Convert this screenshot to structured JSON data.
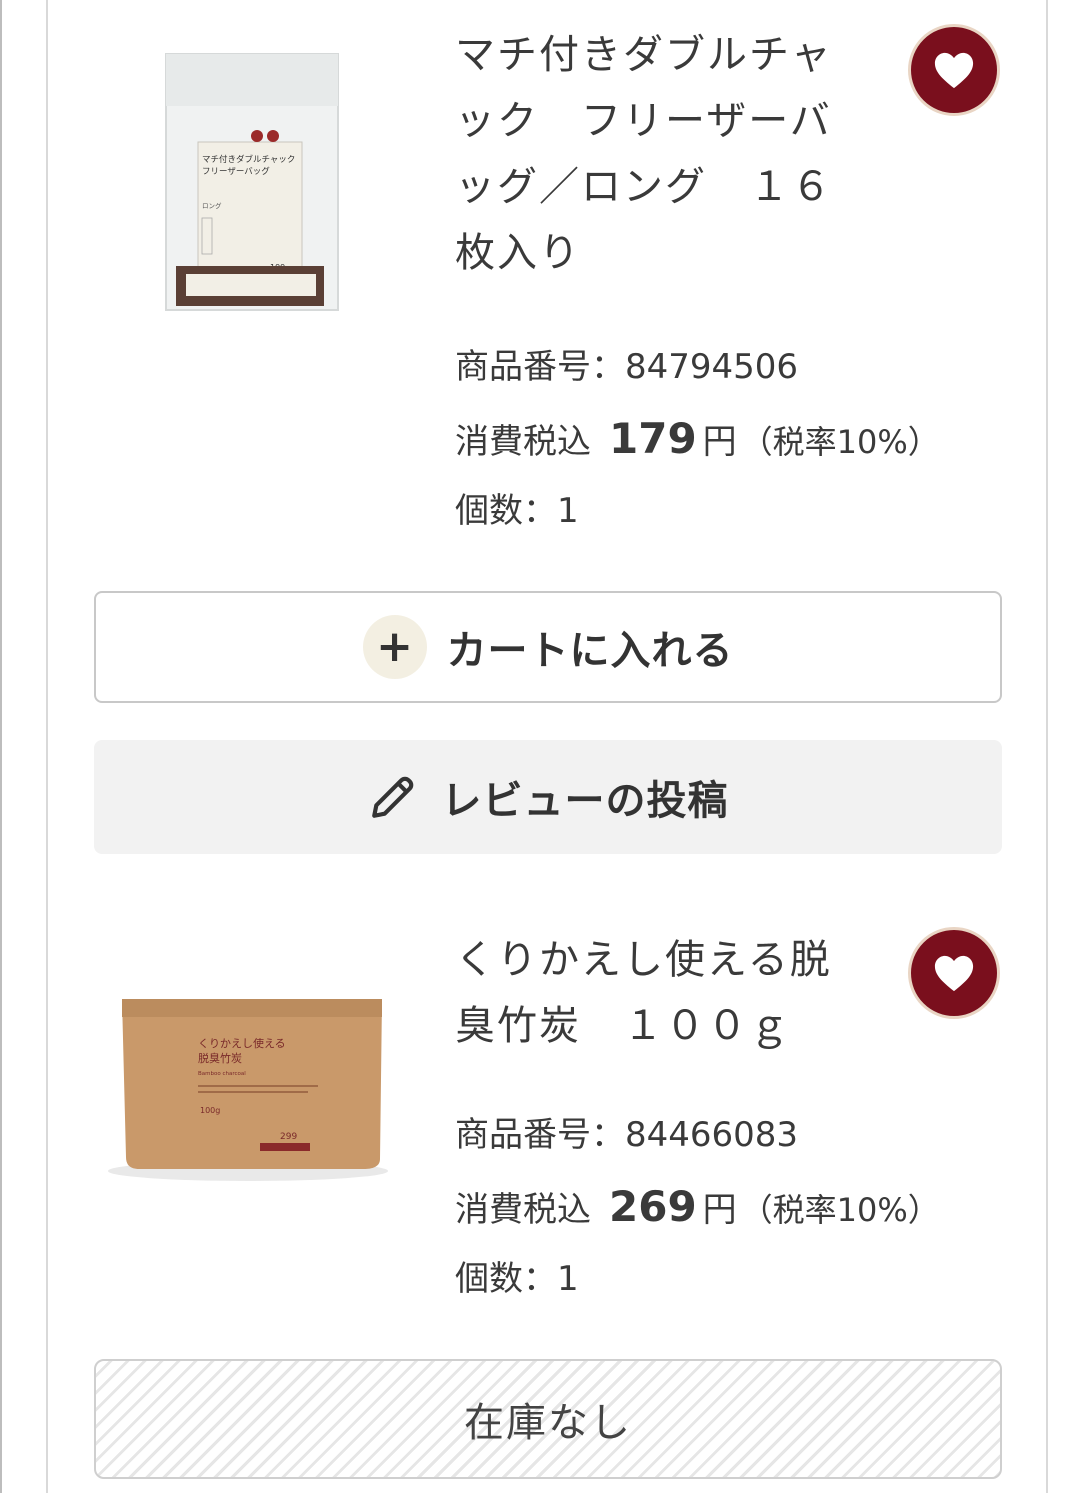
{
  "items": [
    {
      "title": "マチ付きダブルチャック　フリーザーバッグ／ロング　１６枚入り",
      "code_label": "商品番号：",
      "code": "84794506",
      "tax_label": "消費税込",
      "price": "179",
      "yen": "円",
      "tax_rate": "（税率10%）",
      "qty_label": "個数：",
      "qty": "1",
      "package_lines": [
        "マチ付きダブルチャック",
        "フリーザーバッグ",
        "ロング",
        "199"
      ],
      "favorite_icon": "heart-icon"
    },
    {
      "title": "くりかえし使える脱臭竹炭　１００ｇ",
      "code_label": "商品番号：",
      "code": "84466083",
      "tax_label": "消費税込",
      "price": "269",
      "yen": "円",
      "tax_rate": "（税率10%）",
      "qty_label": "個数：",
      "qty": "1",
      "package_lines": [
        "くりかえし使える",
        "脱臭竹炭",
        "Bamboo charcoal",
        "100g",
        "299"
      ],
      "favorite_icon": "heart-icon"
    }
  ],
  "buttons": {
    "cart_label": "カートに入れる",
    "cart_icon": "plus-icon",
    "review_label": "レビューの投稿",
    "review_icon": "pencil-icon",
    "out_of_stock_label": "在庫なし"
  },
  "colors": {
    "favorite_bg": "#7a0f1d",
    "favorite_ring": "#e9d5c4",
    "plus_circle_bg": "#f3efe2",
    "review_bg": "#f2f2f2"
  }
}
